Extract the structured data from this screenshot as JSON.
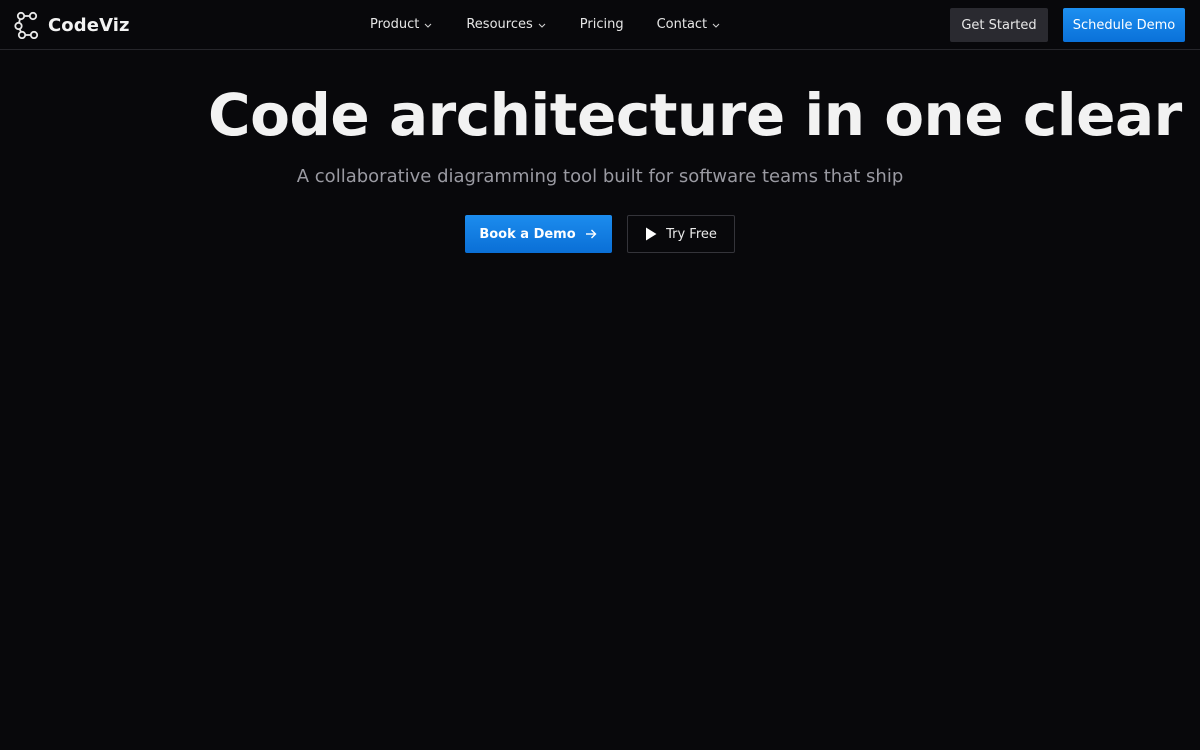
{
  "brand": {
    "name": "CodeViz",
    "icon": "graph-nodes-icon"
  },
  "nav": {
    "items": [
      {
        "label": "Product",
        "has_dropdown": true
      },
      {
        "label": "Resources",
        "has_dropdown": true
      },
      {
        "label": "Pricing",
        "has_dropdown": false
      },
      {
        "label": "Contact",
        "has_dropdown": true
      }
    ],
    "get_started_label": "Get Started",
    "schedule_demo_label": "Schedule Demo"
  },
  "hero": {
    "title": "Code architecture in one clear view",
    "subtitle": "A collaborative diagramming tool built for software teams that ship",
    "book_demo_label": "Book a Demo",
    "try_free_label": "Try Free"
  },
  "colors": {
    "background": "#08080b",
    "accent": "#0a71d9",
    "secondary_button": "#2a2a30"
  }
}
